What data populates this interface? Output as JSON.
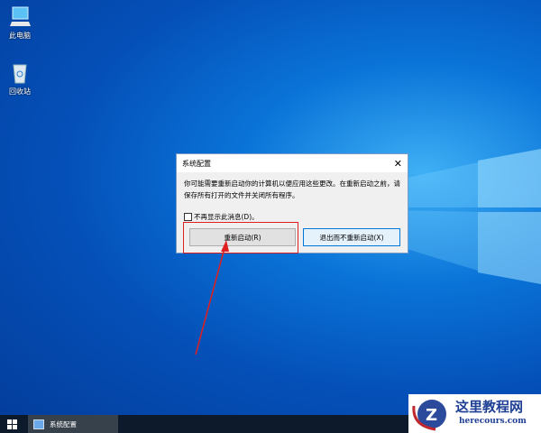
{
  "desktop": {
    "icons": [
      {
        "label": "此电脑",
        "icon": "computer-icon"
      },
      {
        "label": "回收站",
        "icon": "recycle-bin-icon"
      }
    ]
  },
  "dialog": {
    "title": "系统配置",
    "message": "你可能需要重新启动你的计算机以便应用这些更改。在重新启动之前，请保存所有打开的文件并关闭所有程序。",
    "checkbox_label": "不再显示此消息(D)。",
    "checkbox_checked": false,
    "restart_label": "重新启动(R)",
    "exit_label": "退出而不重新启动(X)",
    "highlight_color": "#e02020"
  },
  "taskbar": {
    "app_label": "系统配置"
  },
  "watermark": {
    "title": "这里教程网",
    "url": "herecours.com"
  }
}
